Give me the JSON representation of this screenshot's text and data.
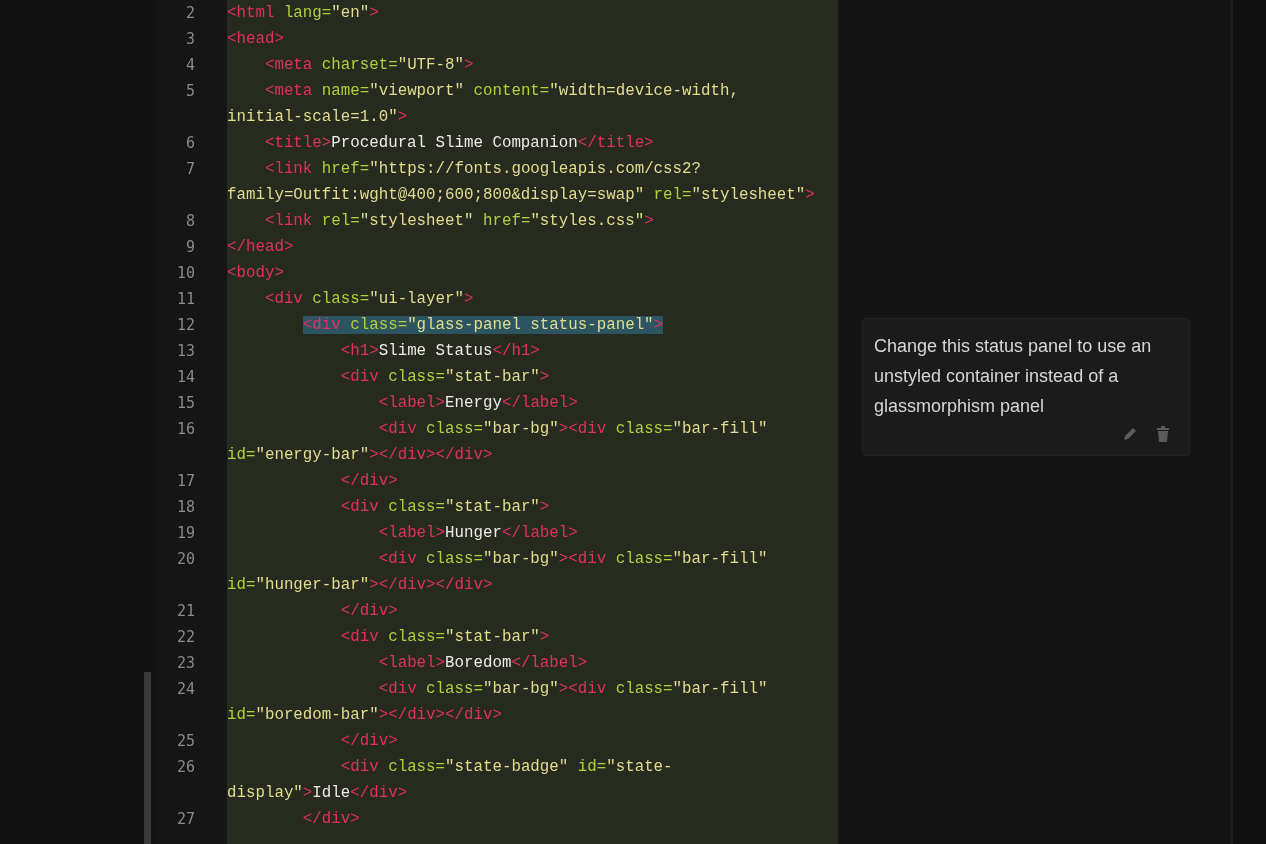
{
  "editor": {
    "rows": [
      {
        "number": "2",
        "indent": "",
        "selected": false,
        "tokens": [
          {
            "kind": "tag",
            "text": "<html"
          },
          {
            "kind": "attr",
            "text": " lang="
          },
          {
            "kind": "string",
            "text": "\"en\""
          },
          {
            "kind": "tag",
            "text": ">"
          }
        ]
      },
      {
        "number": "3",
        "indent": "",
        "selected": false,
        "tokens": [
          {
            "kind": "tag",
            "text": "<head>"
          }
        ]
      },
      {
        "number": "4",
        "indent": "    ",
        "selected": false,
        "tokens": [
          {
            "kind": "tag",
            "text": "<meta"
          },
          {
            "kind": "attr",
            "text": " charset="
          },
          {
            "kind": "string",
            "text": "\"UTF-8\""
          },
          {
            "kind": "tag",
            "text": ">"
          }
        ]
      },
      {
        "number": "5",
        "indent": "    ",
        "selected": false,
        "tokens": [
          {
            "kind": "tag",
            "text": "<meta"
          },
          {
            "kind": "attr",
            "text": " name="
          },
          {
            "kind": "string",
            "text": "\"viewport\""
          },
          {
            "kind": "attr",
            "text": " content="
          },
          {
            "kind": "string",
            "text": "\"width=device-width,"
          }
        ]
      },
      {
        "indent": "",
        "selected": false,
        "tokens": [
          {
            "kind": "string",
            "text": "initial-scale=1.0\""
          },
          {
            "kind": "tag",
            "text": ">"
          }
        ]
      },
      {
        "number": "6",
        "indent": "    ",
        "selected": false,
        "tokens": [
          {
            "kind": "tag",
            "text": "<title>"
          },
          {
            "kind": "text",
            "text": "Procedural Slime Companion"
          },
          {
            "kind": "tag",
            "text": "</title>"
          }
        ]
      },
      {
        "number": "7",
        "indent": "    ",
        "selected": false,
        "tokens": [
          {
            "kind": "tag",
            "text": "<link"
          },
          {
            "kind": "attr",
            "text": " href="
          },
          {
            "kind": "string",
            "text": "\"https://fonts.googleapis.com/css2?"
          }
        ]
      },
      {
        "indent": "",
        "selected": false,
        "tokens": [
          {
            "kind": "string",
            "text": "family=Outfit:wght@400;600;800&display=swap\""
          },
          {
            "kind": "attr",
            "text": " rel="
          },
          {
            "kind": "string",
            "text": "\"stylesheet\""
          },
          {
            "kind": "tag",
            "text": ">"
          }
        ]
      },
      {
        "number": "8",
        "indent": "    ",
        "selected": false,
        "tokens": [
          {
            "kind": "tag",
            "text": "<link"
          },
          {
            "kind": "attr",
            "text": " rel="
          },
          {
            "kind": "string",
            "text": "\"stylesheet\""
          },
          {
            "kind": "attr",
            "text": " href="
          },
          {
            "kind": "string",
            "text": "\"styles.css\""
          },
          {
            "kind": "tag",
            "text": ">"
          }
        ]
      },
      {
        "number": "9",
        "indent": "",
        "selected": false,
        "tokens": [
          {
            "kind": "tag",
            "text": "</head>"
          }
        ]
      },
      {
        "number": "10",
        "indent": "",
        "selected": false,
        "tokens": [
          {
            "kind": "tag",
            "text": "<body>"
          }
        ]
      },
      {
        "number": "11",
        "indent": "    ",
        "selected": false,
        "tokens": [
          {
            "kind": "tag",
            "text": "<div"
          },
          {
            "kind": "attr",
            "text": " class="
          },
          {
            "kind": "string",
            "text": "\"ui-layer\""
          },
          {
            "kind": "tag",
            "text": ">"
          }
        ]
      },
      {
        "number": "12",
        "indent": "        ",
        "selected": true,
        "tokens": [
          {
            "kind": "tag",
            "text": "<div"
          },
          {
            "kind": "attr",
            "text": " class="
          },
          {
            "kind": "string",
            "text": "\"glass-panel status-panel\""
          },
          {
            "kind": "tag",
            "text": ">"
          }
        ]
      },
      {
        "number": "13",
        "indent": "            ",
        "selected": false,
        "tokens": [
          {
            "kind": "tag",
            "text": "<h1>"
          },
          {
            "kind": "text",
            "text": "Slime Status"
          },
          {
            "kind": "tag",
            "text": "</h1>"
          }
        ]
      },
      {
        "number": "14",
        "indent": "            ",
        "selected": false,
        "tokens": [
          {
            "kind": "tag",
            "text": "<div"
          },
          {
            "kind": "attr",
            "text": " class="
          },
          {
            "kind": "string",
            "text": "\"stat-bar\""
          },
          {
            "kind": "tag",
            "text": ">"
          }
        ]
      },
      {
        "number": "15",
        "indent": "                ",
        "selected": false,
        "tokens": [
          {
            "kind": "tag",
            "text": "<label>"
          },
          {
            "kind": "text",
            "text": "Energy"
          },
          {
            "kind": "tag",
            "text": "</label>"
          }
        ]
      },
      {
        "number": "16",
        "indent": "                ",
        "selected": false,
        "tokens": [
          {
            "kind": "tag",
            "text": "<div"
          },
          {
            "kind": "attr",
            "text": " class="
          },
          {
            "kind": "string",
            "text": "\"bar-bg\""
          },
          {
            "kind": "tag",
            "text": "><div"
          },
          {
            "kind": "attr",
            "text": " class="
          },
          {
            "kind": "string",
            "text": "\"bar-fill\""
          }
        ]
      },
      {
        "indent": "",
        "selected": false,
        "tokens": [
          {
            "kind": "attr",
            "text": "id="
          },
          {
            "kind": "string",
            "text": "\"energy-bar\""
          },
          {
            "kind": "tag",
            "text": "></div></div>"
          }
        ]
      },
      {
        "number": "17",
        "indent": "            ",
        "selected": false,
        "tokens": [
          {
            "kind": "tag",
            "text": "</div>"
          }
        ]
      },
      {
        "number": "18",
        "indent": "            ",
        "selected": false,
        "tokens": [
          {
            "kind": "tag",
            "text": "<div"
          },
          {
            "kind": "attr",
            "text": " class="
          },
          {
            "kind": "string",
            "text": "\"stat-bar\""
          },
          {
            "kind": "tag",
            "text": ">"
          }
        ]
      },
      {
        "number": "19",
        "indent": "                ",
        "selected": false,
        "tokens": [
          {
            "kind": "tag",
            "text": "<label>"
          },
          {
            "kind": "text",
            "text": "Hunger"
          },
          {
            "kind": "tag",
            "text": "</label>"
          }
        ]
      },
      {
        "number": "20",
        "indent": "                ",
        "selected": false,
        "tokens": [
          {
            "kind": "tag",
            "text": "<div"
          },
          {
            "kind": "attr",
            "text": " class="
          },
          {
            "kind": "string",
            "text": "\"bar-bg\""
          },
          {
            "kind": "tag",
            "text": "><div"
          },
          {
            "kind": "attr",
            "text": " class="
          },
          {
            "kind": "string",
            "text": "\"bar-fill\""
          }
        ]
      },
      {
        "indent": "",
        "selected": false,
        "tokens": [
          {
            "kind": "attr",
            "text": "id="
          },
          {
            "kind": "string",
            "text": "\"hunger-bar\""
          },
          {
            "kind": "tag",
            "text": "></div></div>"
          }
        ]
      },
      {
        "number": "21",
        "indent": "            ",
        "selected": false,
        "tokens": [
          {
            "kind": "tag",
            "text": "</div>"
          }
        ]
      },
      {
        "number": "22",
        "indent": "            ",
        "selected": false,
        "tokens": [
          {
            "kind": "tag",
            "text": "<div"
          },
          {
            "kind": "attr",
            "text": " class="
          },
          {
            "kind": "string",
            "text": "\"stat-bar\""
          },
          {
            "kind": "tag",
            "text": ">"
          }
        ]
      },
      {
        "number": "23",
        "indent": "                ",
        "selected": false,
        "tokens": [
          {
            "kind": "tag",
            "text": "<label>"
          },
          {
            "kind": "text",
            "text": "Boredom"
          },
          {
            "kind": "tag",
            "text": "</label>"
          }
        ]
      },
      {
        "number": "24",
        "indent": "                ",
        "selected": false,
        "tokens": [
          {
            "kind": "tag",
            "text": "<div"
          },
          {
            "kind": "attr",
            "text": " class="
          },
          {
            "kind": "string",
            "text": "\"bar-bg\""
          },
          {
            "kind": "tag",
            "text": "><div"
          },
          {
            "kind": "attr",
            "text": " class="
          },
          {
            "kind": "string",
            "text": "\"bar-fill\""
          }
        ]
      },
      {
        "indent": "",
        "selected": false,
        "tokens": [
          {
            "kind": "attr",
            "text": "id="
          },
          {
            "kind": "string",
            "text": "\"boredom-bar\""
          },
          {
            "kind": "tag",
            "text": "></div></div>"
          }
        ]
      },
      {
        "number": "25",
        "indent": "            ",
        "selected": false,
        "tokens": [
          {
            "kind": "tag",
            "text": "</div>"
          }
        ]
      },
      {
        "number": "26",
        "indent": "            ",
        "selected": false,
        "tokens": [
          {
            "kind": "tag",
            "text": "<div"
          },
          {
            "kind": "attr",
            "text": " class="
          },
          {
            "kind": "string",
            "text": "\"state-badge\""
          },
          {
            "kind": "attr",
            "text": " id="
          },
          {
            "kind": "string",
            "text": "\"state-"
          }
        ]
      },
      {
        "indent": "",
        "selected": false,
        "tokens": [
          {
            "kind": "string",
            "text": "display\""
          },
          {
            "kind": "tag",
            "text": ">"
          },
          {
            "kind": "text",
            "text": "Idle"
          },
          {
            "kind": "tag",
            "text": "</div>"
          }
        ]
      },
      {
        "number": "27",
        "indent": "        ",
        "selected": false,
        "tokens": [
          {
            "kind": "tag",
            "text": "</div>"
          }
        ]
      }
    ]
  },
  "comment": {
    "text": "Change this status panel to use an unstyled container instead of a glassmorphism panel"
  }
}
